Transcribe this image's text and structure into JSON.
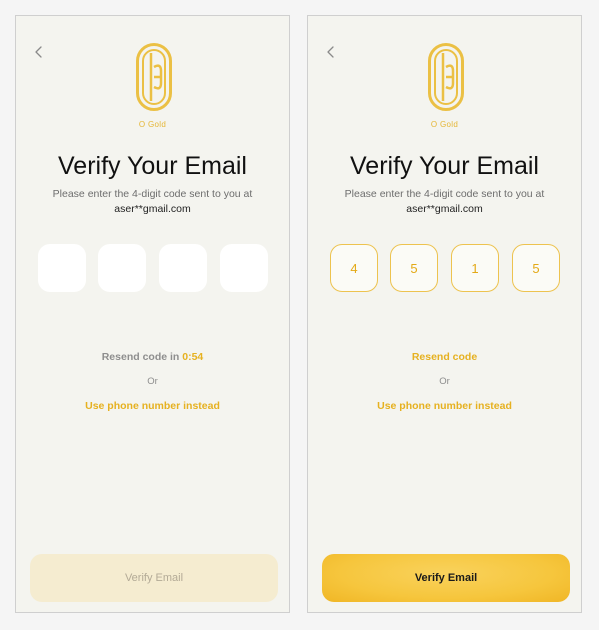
{
  "screens": [
    {
      "id": "left",
      "brand": "O Gold",
      "title": "Verify Your Email",
      "subtitle": "Please enter the 4-digit code sent to you at",
      "email": "aser**gmail.com",
      "code_digits": [
        "",
        "",
        "",
        ""
      ],
      "resend_prefix": "Resend code in",
      "resend_timer": "0:54",
      "or_text": "Or",
      "phone_link": "Use phone number instead",
      "verify_button": "Verify Email",
      "verify_enabled": false
    },
    {
      "id": "right",
      "brand": "O Gold",
      "title": "Verify Your Email",
      "subtitle": "Please enter the 4-digit code sent to you at",
      "email": "aser**gmail.com",
      "code_digits": [
        "4",
        "5",
        "1",
        "5"
      ],
      "resend_label": "Resend code",
      "or_text": "Or",
      "phone_link": "Use phone number instead",
      "verify_button": "Verify Email",
      "verify_enabled": true
    }
  ],
  "colors": {
    "accent": "#e6b120",
    "background": "#f4f4ef",
    "button_disabled": "#f5ecd0",
    "button_active": "#f6c63d"
  },
  "icons": {
    "back": "chevron-left-icon",
    "logo": "o-gold-logo"
  }
}
